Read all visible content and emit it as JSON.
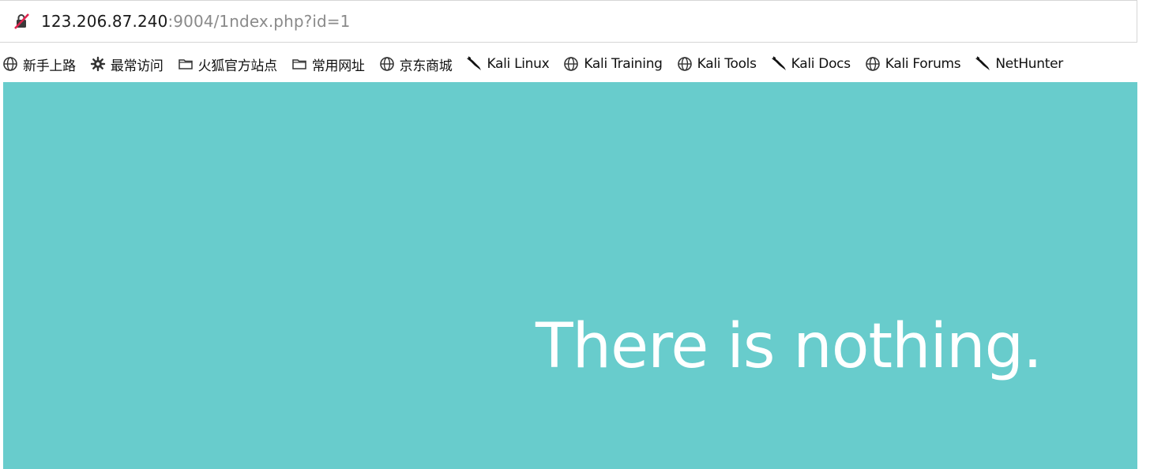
{
  "address_bar": {
    "url_host": "123.206.87.240",
    "url_rest": ":9004/1ndex.php?id=1",
    "security_icon": "insecure-lock-icon"
  },
  "bookmarks": [
    {
      "label": "新手上路",
      "icon": "globe-icon"
    },
    {
      "label": "最常访问",
      "icon": "gear-icon"
    },
    {
      "label": "火狐官方站点",
      "icon": "folder-icon"
    },
    {
      "label": "常用网址",
      "icon": "folder-icon"
    },
    {
      "label": "京东商城",
      "icon": "globe-icon"
    },
    {
      "label": "Kali Linux",
      "icon": "kali-dragon-icon"
    },
    {
      "label": "Kali Training",
      "icon": "globe-icon"
    },
    {
      "label": "Kali Tools",
      "icon": "globe-icon"
    },
    {
      "label": "Kali Docs",
      "icon": "kali-dragon-icon"
    },
    {
      "label": "Kali Forums",
      "icon": "globe-icon"
    },
    {
      "label": "NetHunter",
      "icon": "kali-dragon-icon"
    }
  ],
  "page": {
    "message": "There is nothing.",
    "background_color": "#68cccc",
    "text_color": "#ffffff"
  }
}
